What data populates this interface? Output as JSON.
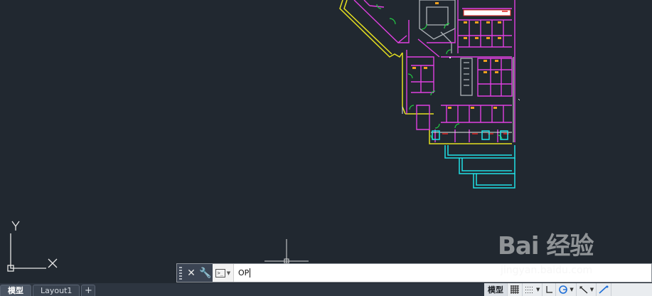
{
  "canvas": {
    "background": "#212830",
    "layers": {
      "walls": "#e040e0",
      "outline": "#e8e8e8",
      "yellow": "#e6e020",
      "cyan": "#20e0e6",
      "green": "#22cc44",
      "orange": "#f0a020",
      "red": "#e02020"
    }
  },
  "ucs": {
    "x_label": "X",
    "y_label": "Y"
  },
  "command_line": {
    "input_value": "OP",
    "close_icon": "close-icon",
    "settings_icon": "wrench-icon",
    "prompt_icon": "command-prompt-icon",
    "prompt_glyph": ">_"
  },
  "layout_tabs": {
    "tabs": [
      "模型",
      "Layout1"
    ],
    "active": "模型",
    "add_label": "+"
  },
  "status": {
    "model_label": "模型",
    "items": [
      "grid-icon",
      "snap-icon",
      "ortho-icon",
      "polar-icon",
      "osnap-icon",
      "dynamic-icon"
    ]
  },
  "watermark": {
    "logo": "Bai 经验",
    "site": "jingyan.baidu.com"
  }
}
